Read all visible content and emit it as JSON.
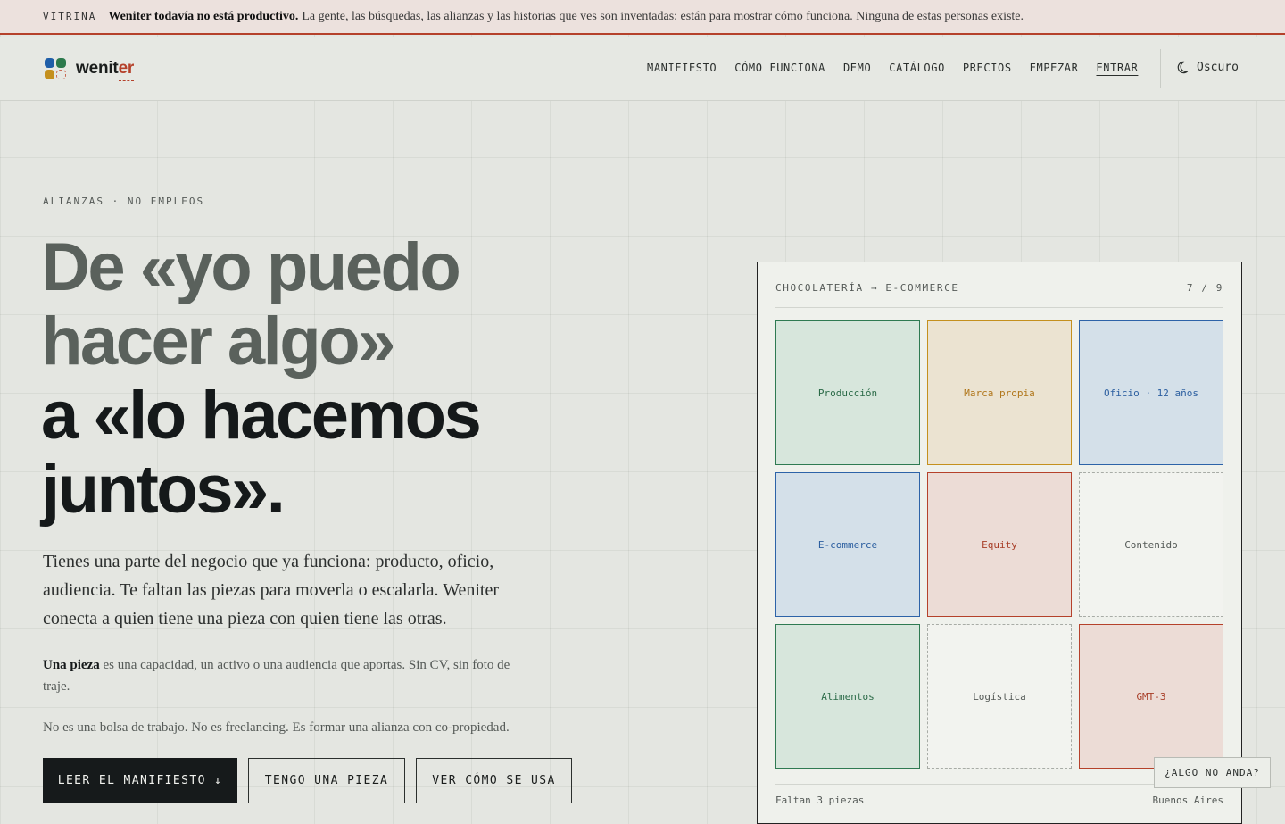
{
  "banner": {
    "tag": "VITRINA",
    "bold": "Weniter todavía no está productivo.",
    "text": "La gente, las búsquedas, las alianzas y las historias que ves son inventadas: están para mostrar cómo funciona. Ninguna de estas personas existe."
  },
  "header": {
    "logo_text_start": "wenit",
    "logo_text_accent": "er",
    "nav": [
      "MANIFIESTO",
      "CÓMO FUNCIONA",
      "DEMO",
      "CATÁLOGO",
      "PRECIOS",
      "EMPEZAR",
      "ENTRAR"
    ],
    "theme_label": "Oscuro",
    "theme_icon": "moon-icon"
  },
  "hero": {
    "eyebrow": "ALIANZAS · NO EMPLEOS",
    "title_lines_muted": [
      "De «yo puedo",
      "hacer algo»"
    ],
    "title_lines_dark": [
      "a «lo hacemos",
      "juntos»."
    ],
    "lead": "Tienes una parte del negocio que ya funciona: producto, oficio, audiencia. Te faltan las piezas para moverla o escalarla. Weniter conecta a quien tiene una pieza con quien tiene las otras.",
    "definition_term": "Una pieza",
    "definition_text": "es una capacidad, un activo o una audiencia que aportas. Sin CV, sin foto de traje.",
    "not_statement": "No es una bolsa de trabajo. No es freelancing. Es formar una alianza con co-propiedad.",
    "buttons": {
      "primary": "LEER EL MANIFIESTO ↓",
      "secondary": "TENGO UNA PIEZA",
      "tertiary": "VER CÓMO SE USA"
    }
  },
  "card": {
    "title": "CHOCOLATERÍA → E-COMMERCE",
    "count": "7 / 9",
    "cells": [
      {
        "label": "Producción",
        "tone": "green"
      },
      {
        "label": "Marca propia",
        "tone": "yellow"
      },
      {
        "label": "Oficio · 12 años",
        "tone": "blue"
      },
      {
        "label": "E-commerce",
        "tone": "blue"
      },
      {
        "label": "Equity",
        "tone": "red"
      },
      {
        "label": "Contenido",
        "tone": "empty"
      },
      {
        "label": "Alimentos",
        "tone": "green"
      },
      {
        "label": "Logística",
        "tone": "empty"
      },
      {
        "label": "GMT-3",
        "tone": "red"
      }
    ],
    "footer_left": "Faltan 3 piezas",
    "footer_right": "Buenos Aires"
  },
  "help_button": "¿ALGO NO ANDA?",
  "colors": {
    "accent": "#b5412b",
    "green": "#2f7a52",
    "yellow": "#c4901e",
    "blue": "#2d63a8",
    "ink": "#161a1b"
  }
}
